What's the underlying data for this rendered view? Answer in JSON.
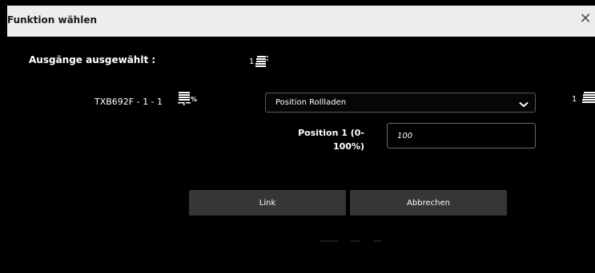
{
  "dialog": {
    "title": "Funktion wählen",
    "close_symbol": "✕",
    "close_icon": "close-icon"
  },
  "outputs": {
    "label": "Ausgänge ausgewählt :",
    "count": "1",
    "icon": "shutter-stack-icon"
  },
  "device": {
    "name": "TXB692F - 1 - 1",
    "icon": "shutter-percent-icon",
    "function_select": {
      "selected": "Position Rollladen",
      "icon": "chevron-down-icon"
    },
    "right_count": "1",
    "right_icon": "shutter-stack-icon"
  },
  "position": {
    "label": "Position 1 (0-100%)",
    "value": "100"
  },
  "buttons": {
    "link": "Link",
    "cancel": "Abbrechen"
  },
  "colors": {
    "titlebar_bg": "#ededed",
    "dialog_bg": "#000000",
    "button_bg": "#363636",
    "field_border": "#6a6a6a"
  }
}
